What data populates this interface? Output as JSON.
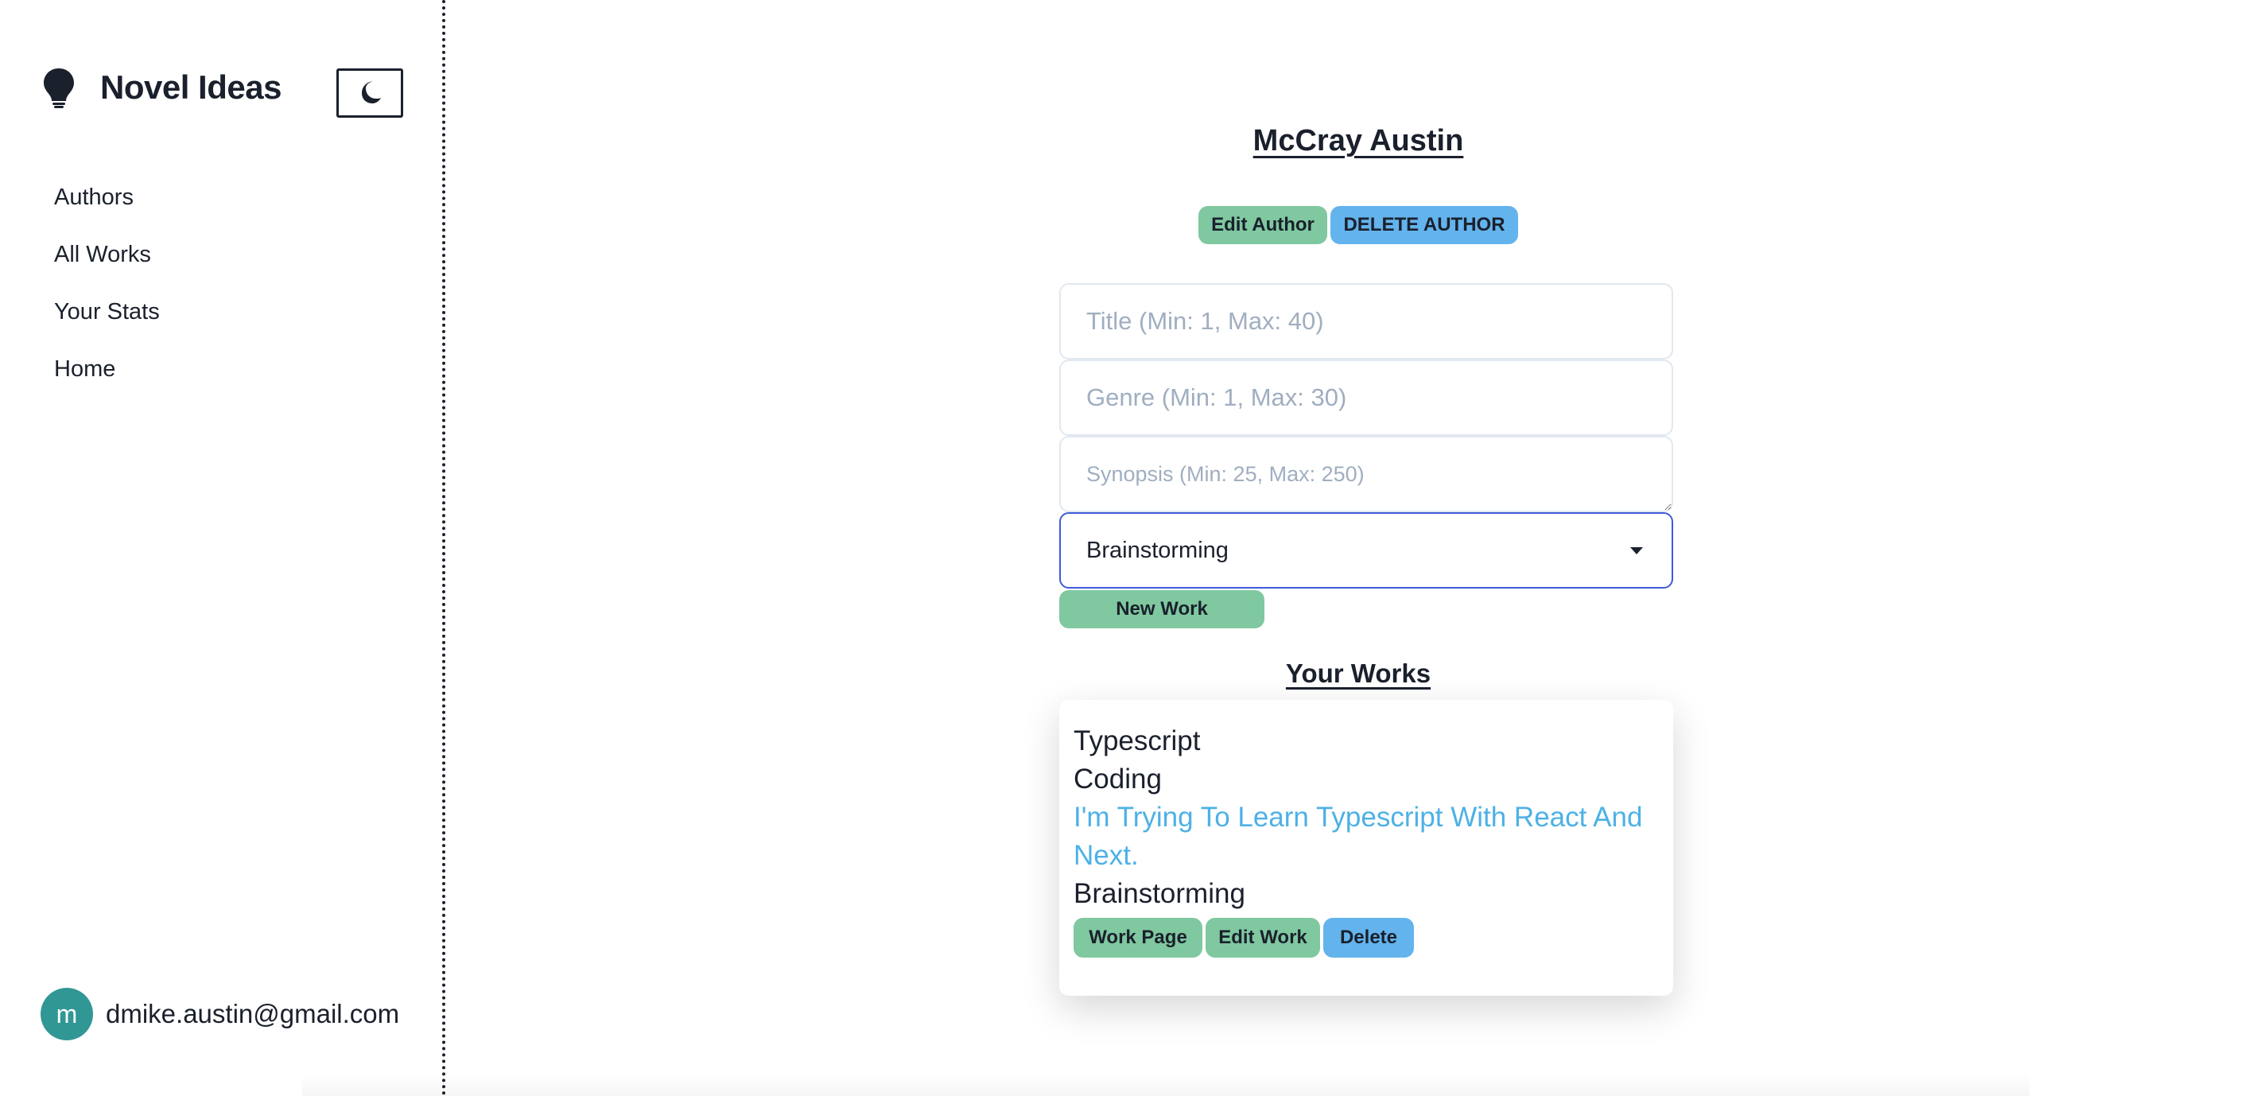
{
  "sidebar": {
    "brand_icon": "lightbulb-icon",
    "brand_title": "Novel Ideas",
    "theme_toggle_icon": "moon-icon",
    "nav": [
      {
        "label": "Authors"
      },
      {
        "label": "All Works"
      },
      {
        "label": "Your Stats"
      },
      {
        "label": "Home"
      }
    ],
    "user": {
      "avatar_initial": "m",
      "email": "dmike.austin@gmail.com"
    }
  },
  "author": {
    "name": "McCray Austin",
    "edit_label": "Edit Author",
    "delete_label": "DELETE AUTHOR"
  },
  "form": {
    "title_placeholder": "Title (Min: 1, Max: 40)",
    "genre_placeholder": "Genre (Min: 1, Max: 30)",
    "synopsis_placeholder": "Synopsis (Min: 25, Max: 250)",
    "status_selected": "Brainstorming",
    "submit_label": "New Work"
  },
  "works": {
    "heading": "Your Works",
    "items": [
      {
        "title": "Typescript",
        "genre": "Coding",
        "synopsis": "I'm Trying To Learn Typescript With React And Next.",
        "status": "Brainstorming",
        "work_page_label": "Work Page",
        "edit_label": "Edit Work",
        "delete_label": "Delete"
      }
    ]
  },
  "colors": {
    "green_button": "#7fc8a0",
    "blue_button": "#63b3ed",
    "synopsis_text": "#4db1e6",
    "avatar_bg": "#319795",
    "select_focus_border": "#3f5bd8"
  }
}
